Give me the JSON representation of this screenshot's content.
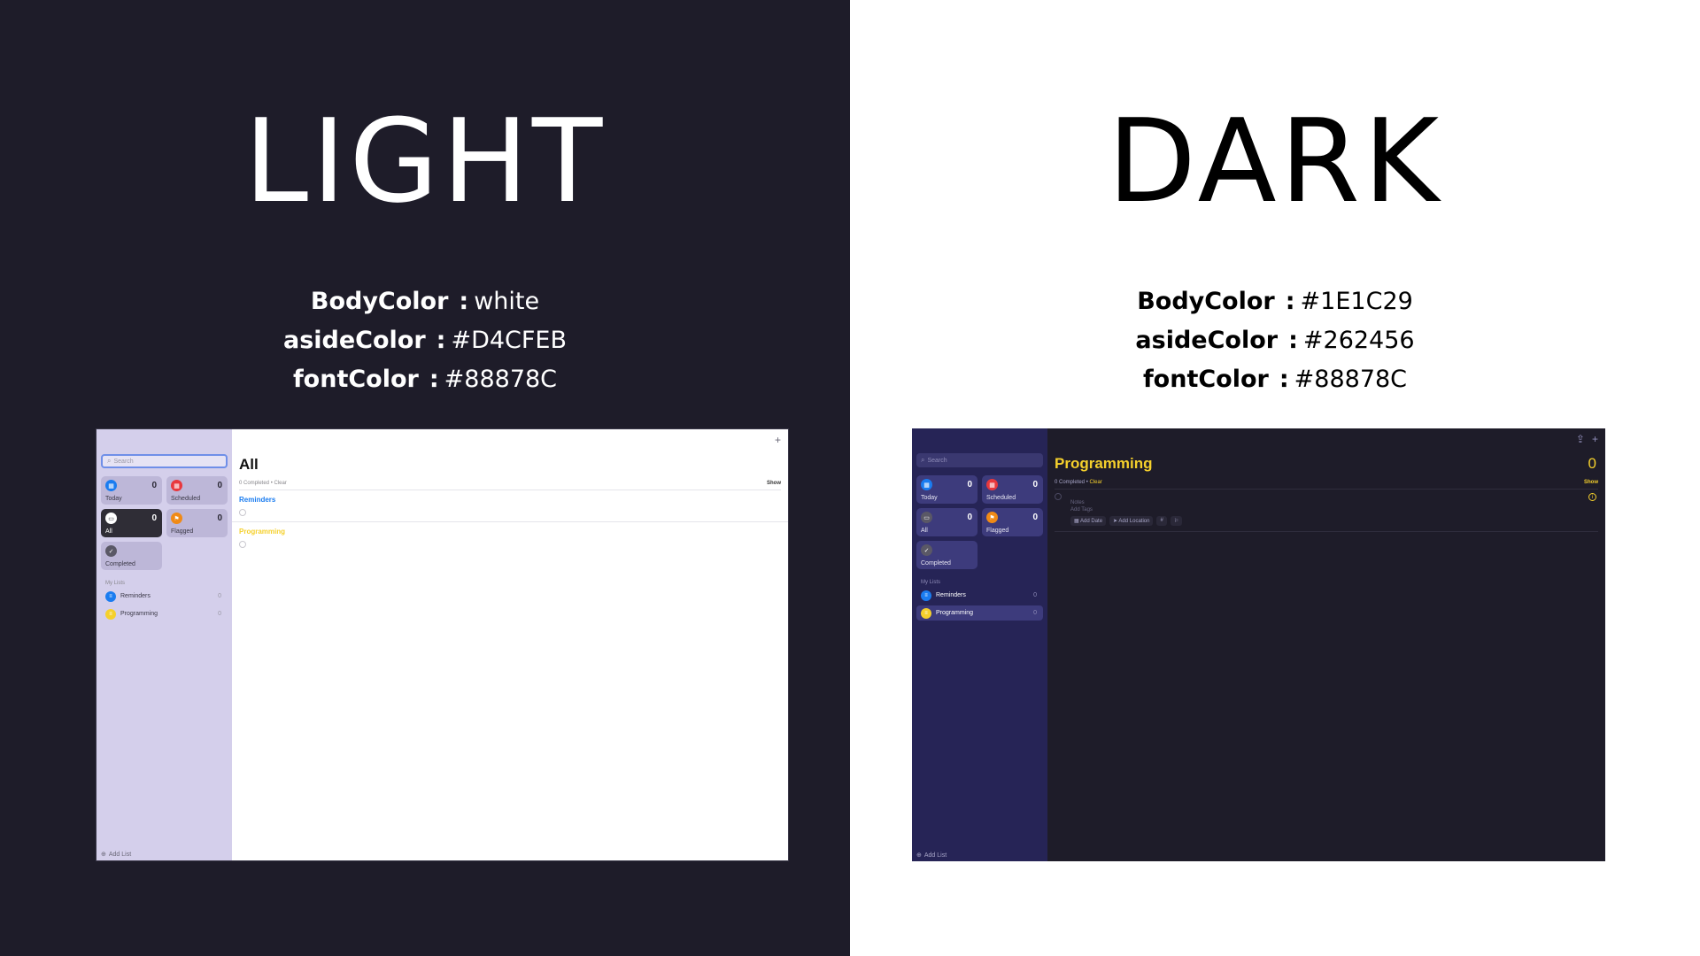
{
  "light": {
    "heading": "LIGHT",
    "props": [
      {
        "key": "BodyColor",
        "value": "white"
      },
      {
        "key": "asideColor",
        "value": "#D4CFEB"
      },
      {
        "key": "fontColor",
        "value": "#88878C"
      }
    ],
    "app": {
      "search_placeholder": "Search",
      "tiles": [
        {
          "label": "Today",
          "count": "0",
          "color": "#1a7cf0",
          "icon": "calendar-icon",
          "glyph": "▦"
        },
        {
          "label": "Scheduled",
          "count": "0",
          "color": "#e8383d",
          "icon": "calendar-icon",
          "glyph": "▦"
        },
        {
          "label": "All",
          "count": "0",
          "color": "#ffffff",
          "icon": "tray-icon",
          "glyph": "▭"
        },
        {
          "label": "Flagged",
          "count": "0",
          "color": "#f08a16",
          "icon": "flag-icon",
          "glyph": "⚑"
        },
        {
          "label": "Completed",
          "color": "#5a5866",
          "icon": "checkmark-icon",
          "glyph": "✓"
        }
      ],
      "my_lists_heading": "My Lists",
      "lists": [
        {
          "label": "Reminders",
          "count": "0",
          "color": "#1a7cf0"
        },
        {
          "label": "Programming",
          "count": "0",
          "color": "#f5d02c"
        }
      ],
      "add_list": "Add List",
      "toolbar_plus": "+",
      "main_title": "All",
      "completed_text": "0 Completed",
      "clear": "Clear",
      "show": "Show",
      "sections": [
        {
          "title": "Reminders",
          "color": "#1a7cf0"
        },
        {
          "title": "Programming",
          "color": "#f5d02c"
        }
      ]
    }
  },
  "dark": {
    "heading": "DARK",
    "props": [
      {
        "key": "BodyColor",
        "value": "#1E1C29"
      },
      {
        "key": "asideColor",
        "value": "#262456"
      },
      {
        "key": "fontColor",
        "value": "#88878C"
      }
    ],
    "app": {
      "search_placeholder": "Search",
      "tiles": [
        {
          "label": "Today",
          "count": "0",
          "color": "#1a7cf0",
          "icon": "calendar-icon",
          "glyph": "▦"
        },
        {
          "label": "Scheduled",
          "count": "0",
          "color": "#e8383d",
          "icon": "calendar-icon",
          "glyph": "▦"
        },
        {
          "label": "All",
          "count": "0",
          "color": "#5a5866",
          "icon": "tray-icon",
          "glyph": "▭"
        },
        {
          "label": "Flagged",
          "count": "0",
          "color": "#f08a16",
          "icon": "flag-icon",
          "glyph": "⚑"
        },
        {
          "label": "Completed",
          "color": "#5a5866",
          "icon": "checkmark-icon",
          "glyph": "✓"
        }
      ],
      "my_lists_heading": "My Lists",
      "lists": [
        {
          "label": "Reminders",
          "count": "0",
          "color": "#1a7cf0"
        },
        {
          "label": "Programming",
          "count": "0",
          "color": "#f5d02c"
        }
      ],
      "add_list": "Add List",
      "toolbar_share": "⇪",
      "toolbar_plus": "+",
      "main_title": "Programming",
      "main_count": "0",
      "completed_text": "0 Completed",
      "clear": "Clear",
      "show": "Show",
      "editor": {
        "notes_placeholder": "Notes",
        "tags_placeholder": "Add Tags",
        "chips": [
          "Add Date",
          "Add Location",
          "#",
          "⚐"
        ]
      }
    }
  }
}
